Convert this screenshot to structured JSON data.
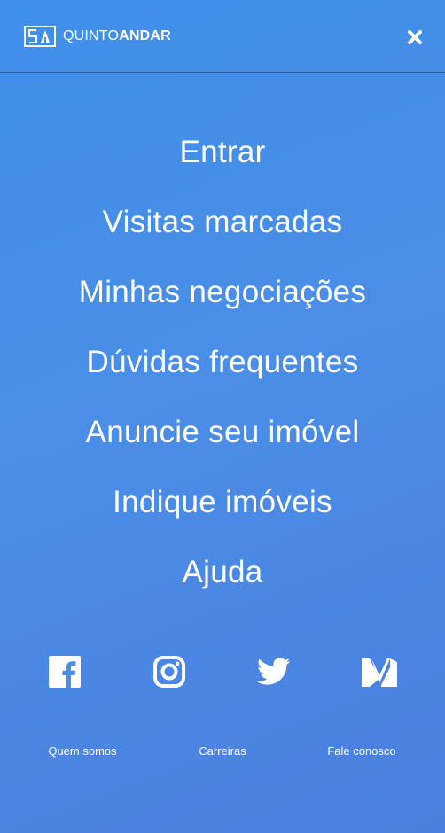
{
  "header": {
    "logo_text_light": "QUINTO",
    "logo_text_bold": "ANDAR",
    "logo_icon": "quintoandar-logo-icon",
    "close_icon": "close-icon"
  },
  "menu": {
    "items": [
      {
        "label": "Entrar"
      },
      {
        "label": "Visitas marcadas"
      },
      {
        "label": "Minhas negociações"
      },
      {
        "label": "Dúvidas frequentes"
      },
      {
        "label": "Anuncie seu imóvel"
      },
      {
        "label": "Indique imóveis"
      },
      {
        "label": "Ajuda"
      }
    ]
  },
  "social": {
    "icons": [
      "facebook-icon",
      "instagram-icon",
      "twitter-icon",
      "medium-icon"
    ]
  },
  "footer": {
    "links": [
      {
        "label": "Quem somos"
      },
      {
        "label": "Carreiras"
      },
      {
        "label": "Fale conosco"
      }
    ]
  },
  "colors": {
    "background_top": "#3f8fe9",
    "background_bottom": "#4b7fdf",
    "text": "#ffffff"
  }
}
